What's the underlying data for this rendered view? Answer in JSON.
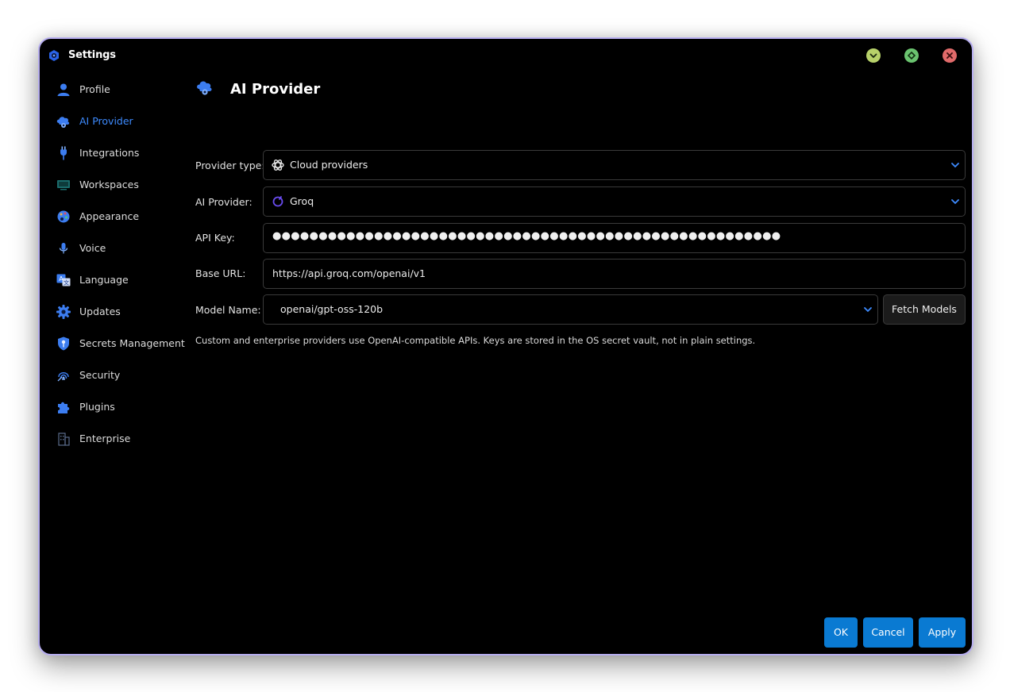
{
  "window": {
    "title": "Settings"
  },
  "sidebar": {
    "items": [
      {
        "label": "Profile",
        "icon": "user-icon"
      },
      {
        "label": "AI Provider",
        "icon": "cloud-gear-icon",
        "active": true
      },
      {
        "label": "Integrations",
        "icon": "plug-icon"
      },
      {
        "label": "Workspaces",
        "icon": "monitor-icon"
      },
      {
        "label": "Appearance",
        "icon": "palette-icon"
      },
      {
        "label": "Voice",
        "icon": "microphone-icon"
      },
      {
        "label": "Language",
        "icon": "translate-icon"
      },
      {
        "label": "Updates",
        "icon": "gear-icon"
      },
      {
        "label": "Secrets Management",
        "icon": "shield-key-icon"
      },
      {
        "label": "Security",
        "icon": "fingerprint-icon"
      },
      {
        "label": "Plugins",
        "icon": "puzzle-icon"
      },
      {
        "label": "Enterprise",
        "icon": "building-icon"
      }
    ]
  },
  "main": {
    "title": "AI Provider",
    "provider_type": {
      "label": "Provider type:",
      "value": "Cloud providers"
    },
    "ai_provider": {
      "label": "AI Provider:",
      "value": "Groq"
    },
    "api_key": {
      "label": "API Key:",
      "value": "●●●●●●●●●●●●●●●●●●●●●●●●●●●●●●●●●●●●●●●●●●●●●●●●●●●●●●●"
    },
    "base_url": {
      "label": "Base URL:",
      "value": "https://api.groq.com/openai/v1"
    },
    "model_name": {
      "label": "Model Name:",
      "value": "openai/gpt-oss-120b"
    },
    "fetch_models_label": "Fetch Models",
    "hint": "Custom and enterprise providers use OpenAI-compatible APIs. Keys are stored in the OS secret vault, not in plain settings."
  },
  "buttons": {
    "ok": "OK",
    "cancel": "Cancel",
    "apply": "Apply"
  },
  "colors": {
    "accent": "#3d8bff",
    "button": "#0a7ad2",
    "window_border": "#b7aef0"
  }
}
